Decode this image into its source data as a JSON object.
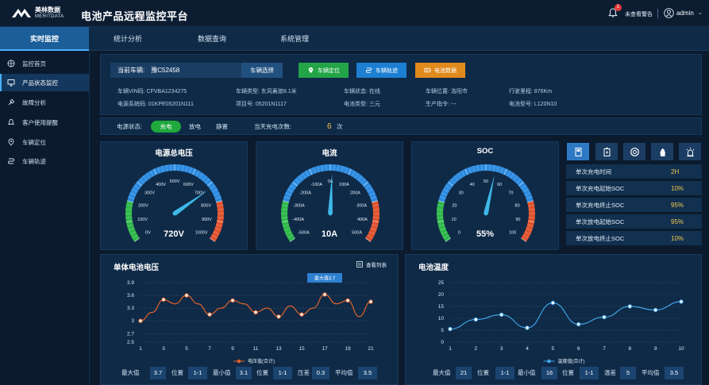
{
  "header": {
    "logo_cn": "美林数据",
    "logo_en": "MERITDATA",
    "title": "电池产品远程监控平台",
    "alarm_badge": "1",
    "alarm_text": "未查看警告",
    "user": "admin",
    "user_caret": "⌄"
  },
  "nav": {
    "tabs": [
      "实时监控",
      "统计分析",
      "数据查询",
      "系统管理"
    ]
  },
  "sidebar": {
    "items": [
      "监控首页",
      "产品状态监控",
      "故障分析",
      "客户使用提醒",
      "车辆定位",
      "车辆轨迹"
    ]
  },
  "vehicle": {
    "current_label": "当前车辆:",
    "current_value": "豫C52458",
    "select_button": "车辆选择",
    "actions": [
      "车辆定位",
      "车辆轨迹",
      "电池数据"
    ],
    "action_colors": [
      "#23a447",
      "#1d7fd1",
      "#e08a1e"
    ],
    "info": [
      "车辆VIN码:  CFVBA1234275",
      "车辆类型: 东风襄旅8.1米",
      "车辆状态: 在线",
      "车辆位置:  洛阳市",
      "行驶里程:  876Km",
      "电源系统码: 01KPE05201N111",
      "项目号:     05201N1117",
      "电池类型: 三元",
      "生产指令:  ---",
      "电池型号:  L120N10"
    ]
  },
  "charge_bar": {
    "label": "电源状态:",
    "states": [
      "充电",
      "放电",
      "静置"
    ],
    "count_label": "当天充电次数:",
    "count_value": "6",
    "count_unit": "次"
  },
  "gauges": [
    {
      "title": "电源总电压",
      "value_text": "720V",
      "ticks": [
        "0V",
        "100V",
        "200V",
        "300V",
        "400V",
        "500V",
        "600V",
        "700V",
        "800V",
        "900V",
        "1000V"
      ],
      "min": 0,
      "max": 1000,
      "value": 720
    },
    {
      "title": "电流",
      "value_text": "10A",
      "ticks": [
        "-500A",
        "-400A",
        "-300A",
        "-200A",
        "-100A",
        "0A",
        "100A",
        "200A",
        "300A",
        "400A",
        "500A"
      ],
      "min": -500,
      "max": 500,
      "value": 10
    },
    {
      "title": "SOC",
      "value_text": "55%",
      "ticks": [
        "0",
        "10",
        "20",
        "30",
        "40",
        "50",
        "60",
        "70",
        "80",
        "90",
        "100"
      ],
      "min": 0,
      "max": 100,
      "value": 55
    }
  ],
  "metrics": {
    "icons": [
      "charger-icon",
      "battery-icon",
      "lifebuoy-icon",
      "hand-icon",
      "alarm-light-icon"
    ],
    "rows": [
      {
        "label": "单次充电时间",
        "value": "2H"
      },
      {
        "label": "单次充电起始SOC",
        "value": "10%"
      },
      {
        "label": "单次充电终止SOC",
        "value": "95%"
      },
      {
        "label": "单次放电起始SOC",
        "value": "95%"
      },
      {
        "label": "单次放电终止SOC",
        "value": "10%"
      }
    ]
  },
  "voltage_panel": {
    "title": "单体电池电压",
    "list_link": "查看列表",
    "stats": [
      "最大值",
      "3.7",
      "位置",
      "1-1",
      "最小值",
      "3.1",
      "位置",
      "1-1",
      "压差",
      "0.3",
      "平均值",
      "3.5"
    ]
  },
  "temp_panel": {
    "title": "电池温度",
    "stats": [
      "最大值",
      "21",
      "位置",
      "1-1",
      "最小值",
      "16",
      "位置",
      "1-1",
      "温差",
      "5",
      "平均值",
      "3.5"
    ]
  },
  "chart_data": [
    {
      "type": "line",
      "x": [
        1,
        2,
        3,
        4,
        5,
        6,
        7,
        8,
        9,
        10,
        11,
        12,
        13,
        14,
        15,
        16,
        17,
        18,
        19,
        20,
        21
      ],
      "series": [
        {
          "name": "电压值(合计)",
          "values": [
            3.0,
            3.2,
            3.5,
            3.4,
            3.6,
            3.4,
            3.15,
            3.3,
            3.48,
            3.4,
            3.2,
            3.3,
            3.1,
            3.35,
            3.15,
            3.3,
            3.62,
            3.4,
            3.48,
            3.1,
            3.45
          ]
        }
      ],
      "x_ticks": [
        "1",
        "3",
        "5",
        "7",
        "9",
        "11",
        "13",
        "15",
        "17",
        "19",
        "21"
      ],
      "y_ticks": [
        "2.5",
        "2.7",
        "3",
        "3.3",
        "3.6",
        "3.9"
      ],
      "ylim": [
        2.5,
        3.9
      ],
      "annotation": "最大值3.7",
      "color": "#e0622a"
    },
    {
      "type": "line",
      "x": [
        1,
        2,
        3,
        4,
        5,
        6,
        7,
        8,
        9,
        10
      ],
      "series": [
        {
          "name": "温度值(合计)",
          "values": [
            5.5,
            9.5,
            11.5,
            6,
            16.5,
            7.5,
            10.5,
            15,
            13.5,
            17
          ]
        }
      ],
      "x_ticks": [
        "1",
        "2",
        "3",
        "4",
        "5",
        "6",
        "7",
        "8",
        "9",
        "10"
      ],
      "y_ticks": [
        "0",
        "5",
        "10",
        "15",
        "20",
        "25"
      ],
      "ylim": [
        0,
        25
      ],
      "color": "#3fa3e8"
    }
  ]
}
